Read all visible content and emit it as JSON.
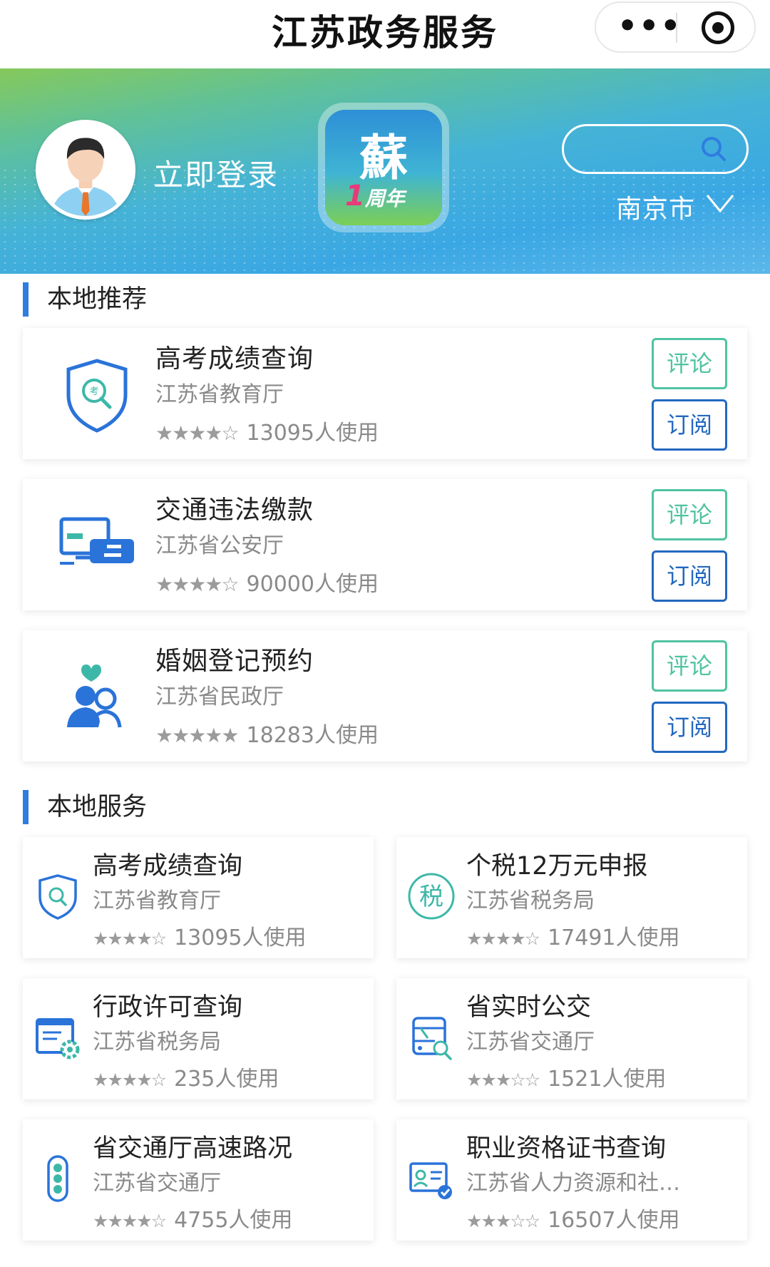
{
  "header": {
    "title": "江苏政务服务",
    "more_label": "•••"
  },
  "banner": {
    "login_text": "立即登录",
    "logo_text": "蘇",
    "logo_anniversary_num": "1",
    "logo_anniversary_text": "周年",
    "city": "南京市"
  },
  "recommend": {
    "section_title": "本地推荐",
    "comment_label": "评论",
    "subscribe_label": "订阅",
    "items": [
      {
        "name": "高考成绩查询",
        "dept": "江苏省教育厅",
        "stars": "★★★★☆",
        "usage": "13095人使用",
        "icon": "exam-shield-icon"
      },
      {
        "name": "交通违法缴款",
        "dept": "江苏省公安厅",
        "stars": "★★★★☆",
        "usage": "90000人使用",
        "icon": "traffic-payment-icon"
      },
      {
        "name": "婚姻登记预约",
        "dept": "江苏省民政厅",
        "stars": "★★★★★",
        "usage": "18283人使用",
        "icon": "marriage-icon"
      }
    ]
  },
  "services": {
    "section_title": "本地服务",
    "items": [
      {
        "name": "高考成绩查询",
        "dept": "江苏省教育厅",
        "stars": "★★★★☆",
        "usage": "13095人使用",
        "icon": "exam-shield-icon"
      },
      {
        "name": "个税12万元申报",
        "dept": "江苏省税务局",
        "stars": "★★★★☆",
        "usage": "17491人使用",
        "icon": "tax-icon",
        "icon_text": "税"
      },
      {
        "name": "行政许可查询",
        "dept": "江苏省税务局",
        "stars": "★★★★☆",
        "usage": "235人使用",
        "icon": "license-gear-icon"
      },
      {
        "name": "省实时公交",
        "dept": "江苏省交通厅",
        "stars": "★★★☆☆",
        "usage": "1521人使用",
        "icon": "bus-search-icon"
      },
      {
        "name": "省交通厅高速路况",
        "dept": "江苏省交通厅",
        "stars": "★★★★☆",
        "usage": "4755人使用",
        "icon": "traffic-light-icon"
      },
      {
        "name": "职业资格证书查询",
        "dept": "江苏省人力资源和社…",
        "stars": "★★★☆☆",
        "usage": "16507人使用",
        "icon": "certificate-icon"
      }
    ]
  },
  "colors": {
    "accent_blue": "#2f7de1",
    "comment_green": "#4fc3a1",
    "subscribe_blue": "#2268c0",
    "icon_blue": "#2a73d9"
  }
}
